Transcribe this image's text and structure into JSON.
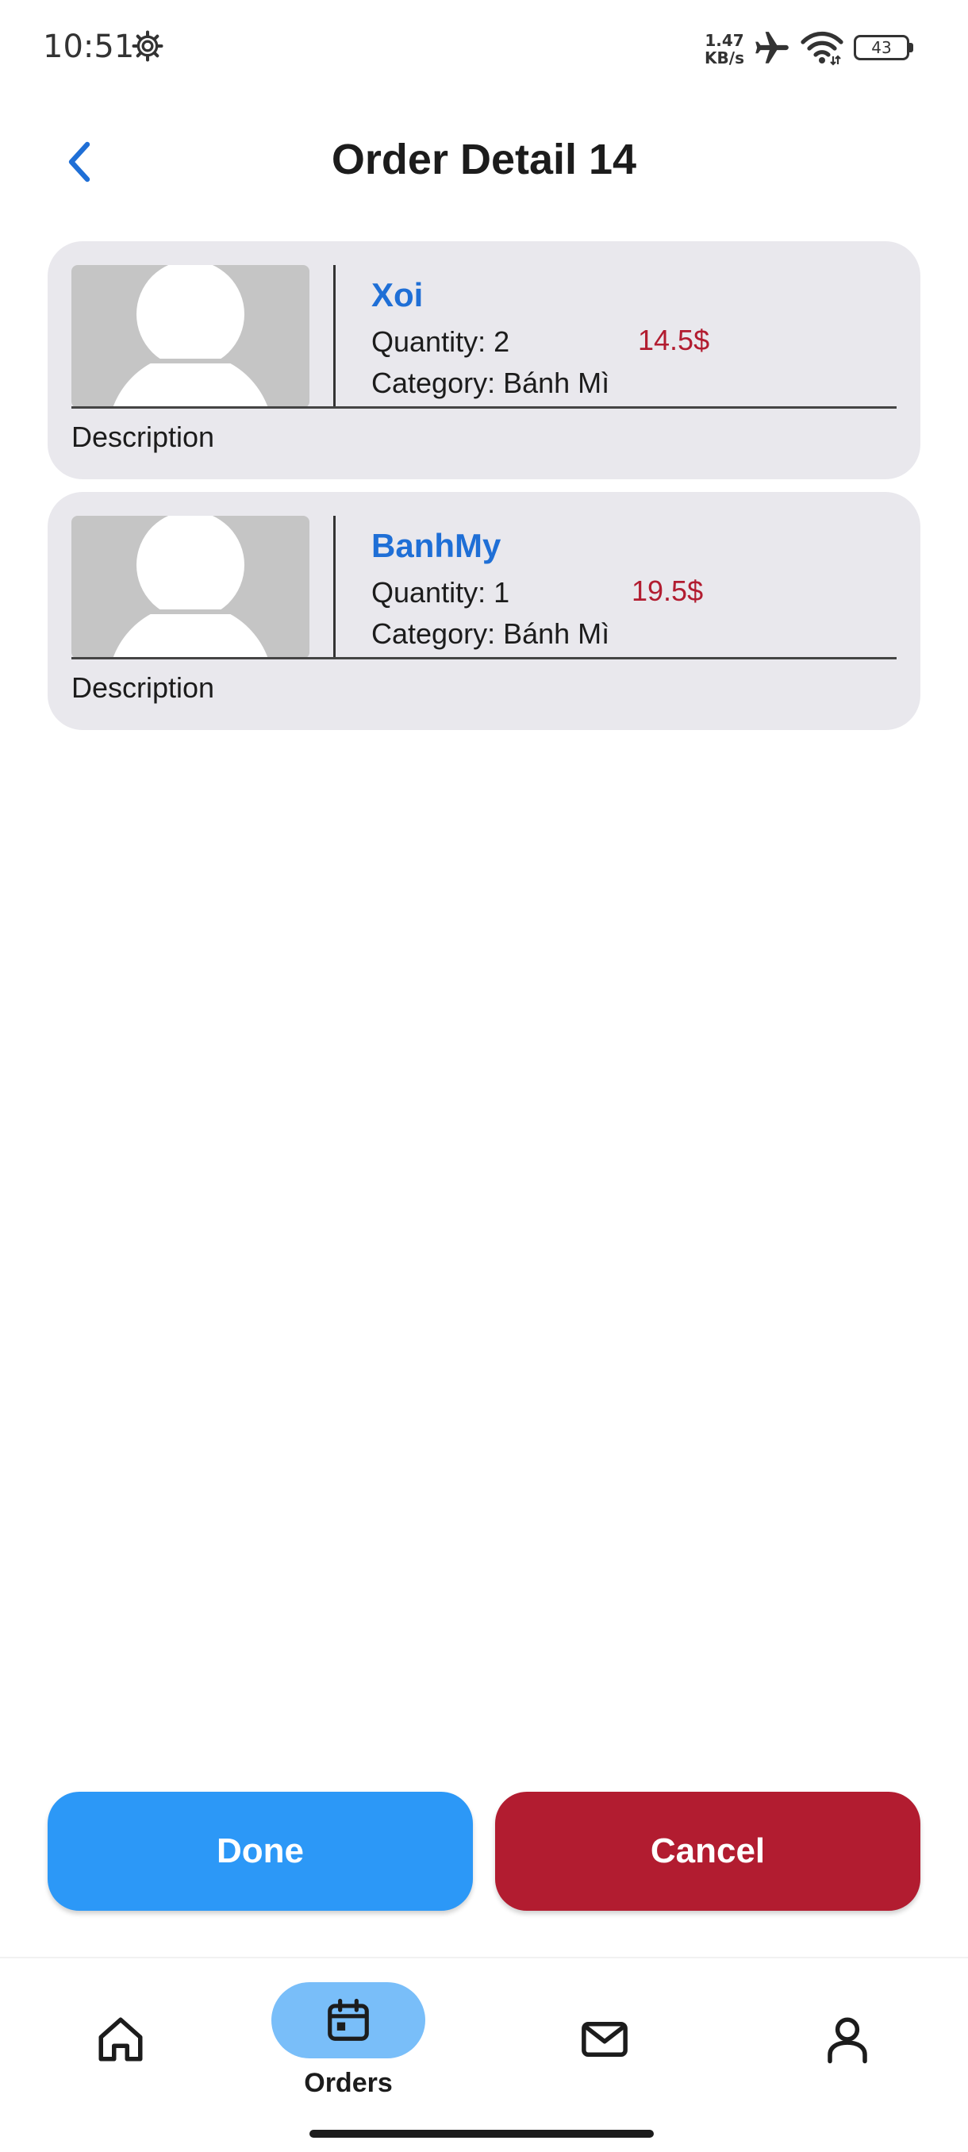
{
  "status_bar": {
    "time": "10:51",
    "net_speed_value": "1.47",
    "net_speed_unit": "KB/s",
    "battery": "43",
    "icons": [
      "settings-gear-icon",
      "airplane-icon",
      "wifi-icon",
      "battery-icon"
    ]
  },
  "header": {
    "title": "Order Detail 14",
    "back_icon": "chevron-left-icon"
  },
  "order_items": [
    {
      "name": "Xoi",
      "quantity": "Quantity: 2",
      "price": "14.5$",
      "category": "Category: Bánh Mì",
      "description": "Description"
    },
    {
      "name": "BanhMy",
      "quantity": "Quantity: 1",
      "price": "19.5$",
      "category": "Category: Bánh Mì",
      "description": "Description"
    }
  ],
  "actions": {
    "done_label": "Done",
    "cancel_label": "Cancel"
  },
  "bottom_nav": {
    "items": [
      {
        "icon": "home-icon",
        "label": "",
        "active": false
      },
      {
        "icon": "calendar-icon",
        "label": "Orders",
        "active": true
      },
      {
        "icon": "mail-icon",
        "label": "",
        "active": false
      },
      {
        "icon": "person-icon",
        "label": "",
        "active": false
      }
    ]
  },
  "colors": {
    "accent_blue": "#1f6fd6",
    "done_button": "#2c98f7",
    "cancel_button": "#b21c30",
    "price_red": "#b21c30",
    "card_background": "#e9e8ed",
    "nav_active_pill": "#79bef9"
  }
}
